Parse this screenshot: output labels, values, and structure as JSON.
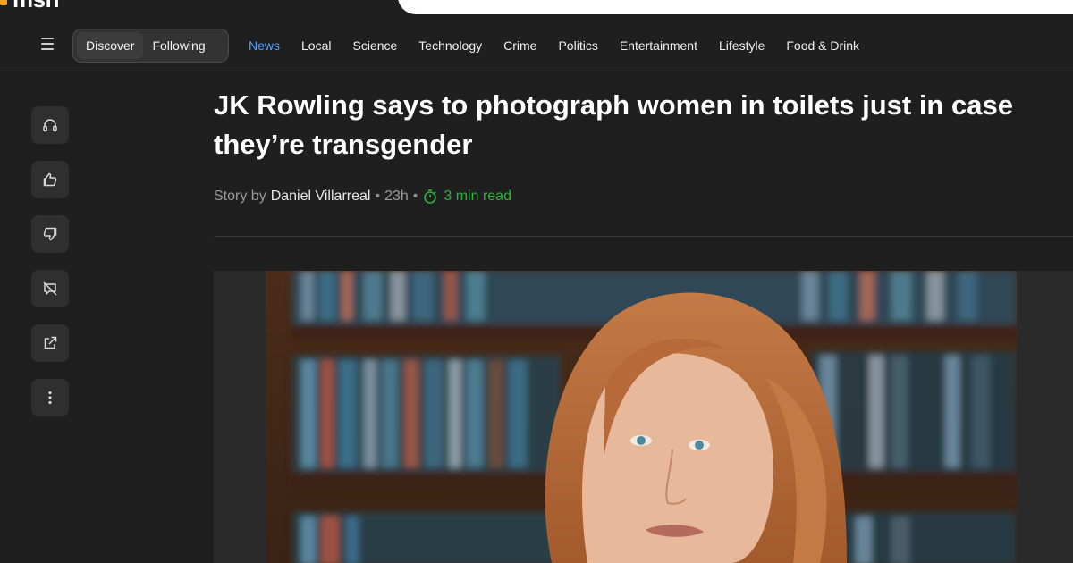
{
  "brand": {
    "logo_text": "msn"
  },
  "nav": {
    "menu_icon": "hamburger-icon",
    "toggle": [
      "Discover",
      "Following"
    ],
    "links": [
      {
        "label": "News",
        "active": true
      },
      {
        "label": "Local"
      },
      {
        "label": "Science"
      },
      {
        "label": "Technology"
      },
      {
        "label": "Crime"
      },
      {
        "label": "Politics"
      },
      {
        "label": "Entertainment"
      },
      {
        "label": "Lifestyle"
      },
      {
        "label": "Food & Drink"
      }
    ]
  },
  "sidebar": {
    "buttons": [
      {
        "icon": "headphones-icon"
      },
      {
        "icon": "thumbs-up-icon"
      },
      {
        "icon": "thumbs-down-icon"
      },
      {
        "icon": "comments-off-icon"
      },
      {
        "icon": "share-icon"
      },
      {
        "icon": "more-vertical-icon"
      }
    ]
  },
  "article": {
    "title": "JK Rowling says to photograph women in toilets just in case they’re transgender",
    "story_by": "Story by",
    "author": "Daniel Villarreal",
    "age": "23h",
    "read_time": "3 min read"
  },
  "colors": {
    "background": "#1f1f1f",
    "accent_link": "#4da3ff",
    "read_time": "#31b041",
    "logo": "#f3a21b"
  }
}
